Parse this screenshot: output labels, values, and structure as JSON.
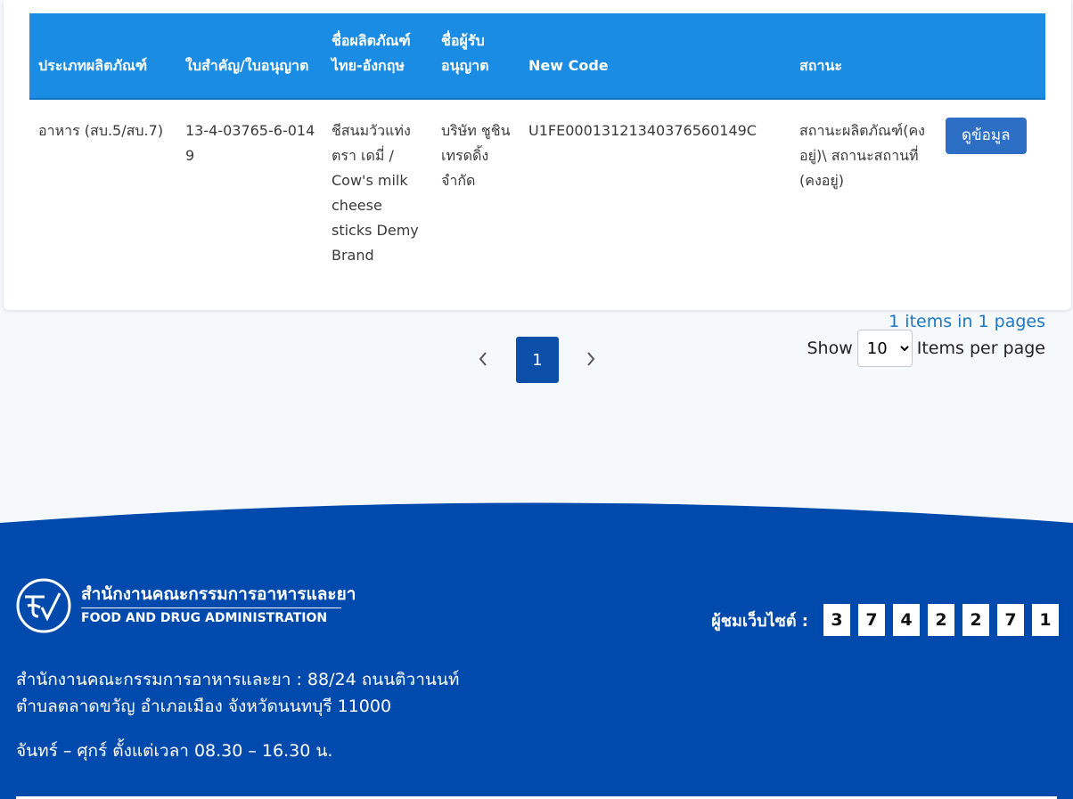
{
  "table": {
    "columns": [
      "ประเภทผลิตภัณฑ์",
      "ใบสำคัญ/ใบอนุญาต",
      "ชื่อผลิตภัณฑ์ ไทย-อังกฤษ",
      "ชื่อผู้รับอนุญาต",
      "New Code",
      "สถานะ",
      ""
    ],
    "rows": [
      {
        "type": "อาหาร (สบ.5/สบ.7)",
        "license": "13-4-03765-6-0149",
        "product": "ชีสนมวัวแท่ง ตรา เดมี่ / Cow's milk cheese sticks Demy Brand",
        "licensee": "บริษัท ชูชิน เทรดดิ้ง จำกัด",
        "new_code": "U1FE000131213403765601​49C",
        "status": "สถานะผลิตภัณฑ์(คงอยู่)\\ สถานะสถานที่ (คงอยู่)",
        "action_label": "ดูข้อมูล"
      }
    ]
  },
  "pagination": {
    "current_page": "1",
    "items_info": "1 items in 1 pages",
    "show_label": "Show",
    "per_page_value": "10",
    "per_page_suffix": "Items per page"
  },
  "footer": {
    "org_name_th": "สำนักงานคณะกรรมการอาหารและยา",
    "org_name_en": "FOOD AND DRUG ADMINISTRATION",
    "visitors_label": "ผู้ชมเว็บไซต์ :",
    "visitor_digits": [
      "3",
      "7",
      "4",
      "2",
      "2",
      "7",
      "1"
    ],
    "address_line1": "สำนักงานคณะกรรมการอาหารและยา : 88/24 ถนนติวานนท์",
    "address_line2": "ตำบลตลาดขวัญ อำเภอเมือง จังหวัดนนทบุรี 11000",
    "hours": "จันทร์ – ศุกร์ ตั้งแต่เวลา 08.30 – 16.30 น."
  },
  "colors": {
    "header_blue": "#1a8ce3",
    "button_blue": "#2e6fc6",
    "pager_active": "#0c4fa9",
    "footer_blue": "#004aad"
  }
}
